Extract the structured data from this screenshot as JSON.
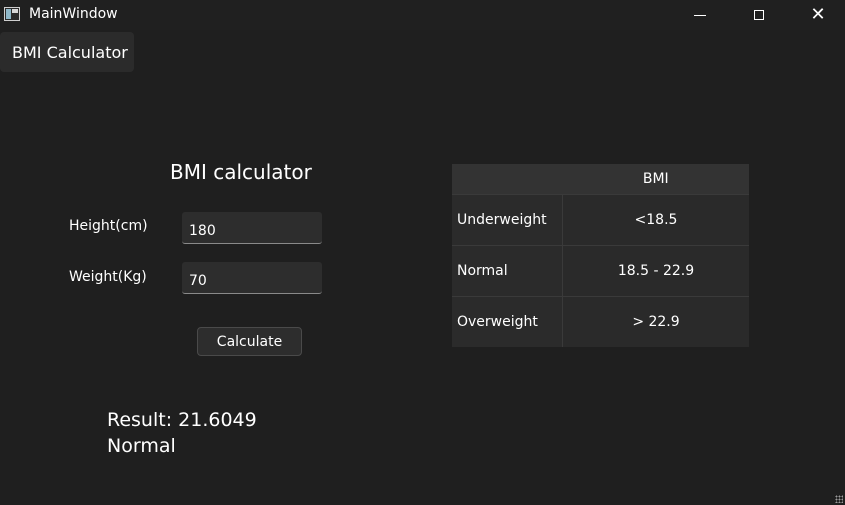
{
  "window": {
    "title": "MainWindow",
    "controls": [
      "minimize",
      "maximize",
      "close"
    ]
  },
  "menu": {
    "items": [
      {
        "label": "BMI Calculator"
      }
    ]
  },
  "form": {
    "title": "BMI calculator",
    "height_label": "Height(cm)",
    "height_value": "180",
    "weight_label": "Weight(Kg)",
    "weight_value": "70",
    "calculate_label": "Calculate"
  },
  "result": {
    "line1": "Result: 21.6049",
    "line2": "Normal"
  },
  "table": {
    "columns": [
      "",
      "BMI"
    ],
    "rows": [
      {
        "header": "Underweight",
        "bmi": "<18.5"
      },
      {
        "header": "Normal",
        "bmi": "18.5 - 22.9"
      },
      {
        "header": "Overweight",
        "bmi": "> 22.9"
      }
    ]
  }
}
